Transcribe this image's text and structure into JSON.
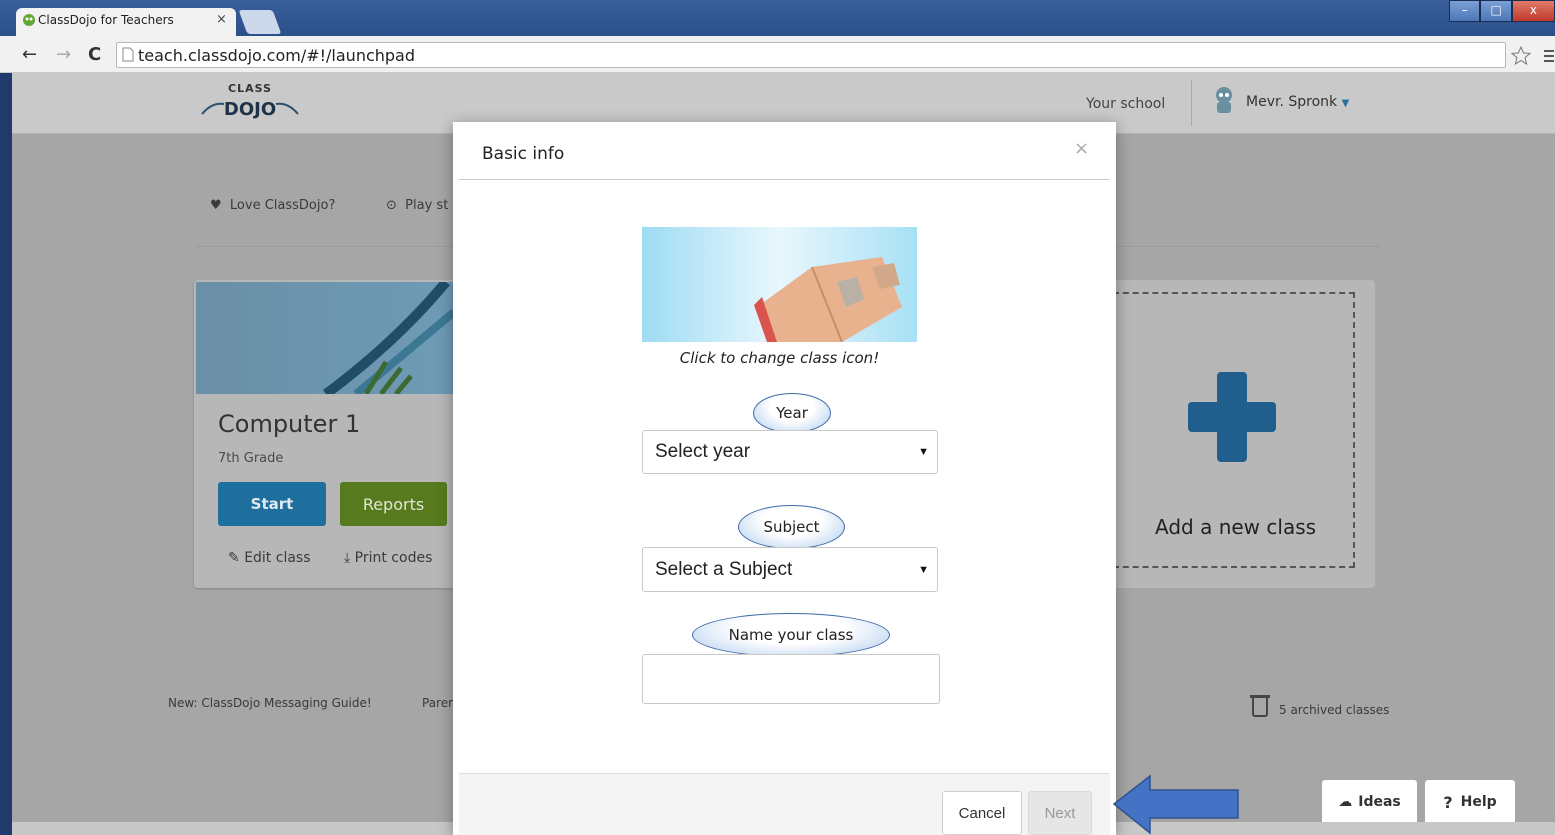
{
  "browser": {
    "tab_title": "ClassDojo for Teachers",
    "tab_close": "×",
    "url": "teach.classdojo.com/#!/launchpad",
    "window_controls": [
      "–",
      "□",
      "x"
    ]
  },
  "header": {
    "logo_top": "CLASS",
    "logo_bottom": "DOJO",
    "school_link": "Your school",
    "user_name": "Mevr. Spronk"
  },
  "toplinks": {
    "love": "Love ClassDojo?",
    "play": "Play st"
  },
  "class_card": {
    "name": "Computer 1",
    "grade": "7th Grade",
    "start_label": "Start",
    "reports_label": "Reports",
    "edit_label": "Edit class",
    "print_label": "Print codes"
  },
  "add_class": {
    "label": "Add a new class"
  },
  "footer_links": {
    "messaging": "New: ClassDojo Messaging Guide!",
    "parent": "Paren",
    "archived": "5 archived classes"
  },
  "help_buttons": {
    "ideas": "Ideas",
    "help": "Help"
  },
  "modal": {
    "title": "Basic info",
    "close": "×",
    "icon_caption": "Click to change class icon!",
    "year_label": "Year",
    "year_select": "Select year",
    "subject_label": "Subject",
    "subject_select": "Select a Subject",
    "name_label": "Name your class",
    "name_value": "",
    "cancel_label": "Cancel",
    "next_label": "Next"
  },
  "colors": {
    "start_button": "#1e6f9d",
    "reports_button": "#577a1e",
    "plus_icon": "#205e8d",
    "pointer_arrow": "#4472c4"
  }
}
